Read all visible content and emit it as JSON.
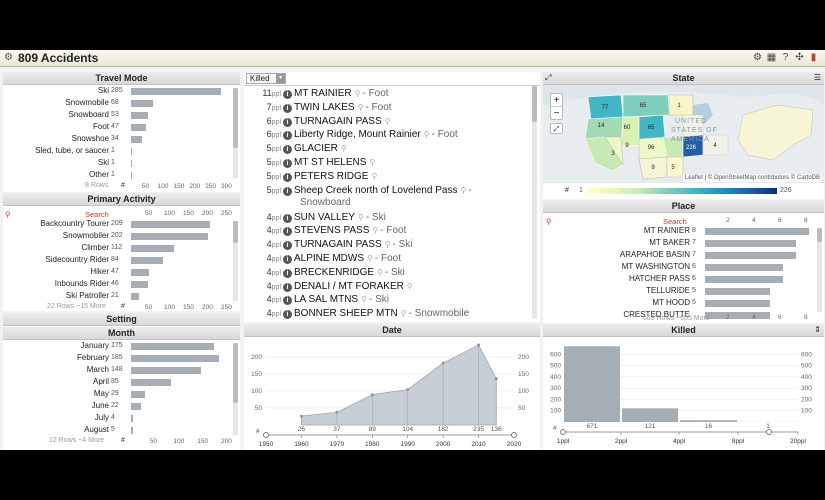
{
  "app": {
    "title": "809 Accidents"
  },
  "travel_mode": {
    "title": "Travel Mode",
    "items": [
      {
        "label": "Ski",
        "count": "285",
        "value": 285
      },
      {
        "label": "Snowmobile",
        "count": "68",
        "value": 68
      },
      {
        "label": "Snowboard",
        "count": "53",
        "value": 53
      },
      {
        "label": "Foot",
        "count": "47",
        "value": 47
      },
      {
        "label": "Snowshoe",
        "count": "34",
        "value": 34
      },
      {
        "label": "Sled, tube, or saucer",
        "count": "1",
        "value": 1
      },
      {
        "label": "Ski",
        "count": "1",
        "value": 1
      },
      {
        "label": "Other",
        "count": "1",
        "value": 1
      }
    ],
    "footer": "8 Rows",
    "axis": [
      "50",
      "100",
      "150",
      "200",
      "250",
      "300"
    ],
    "max": 300
  },
  "primary_activity": {
    "title": "Primary Activity",
    "search": "Search",
    "items": [
      {
        "label": "Backcountry Tourer",
        "count": "209",
        "value": 209
      },
      {
        "label": "Snowmobiler",
        "count": "202",
        "value": 202
      },
      {
        "label": "Climber",
        "count": "112",
        "value": 112
      },
      {
        "label": "Sidecountry Rider",
        "count": "84",
        "value": 84
      },
      {
        "label": "Hiker",
        "count": "47",
        "value": 47
      },
      {
        "label": "Inbounds Rider",
        "count": "46",
        "value": 46
      },
      {
        "label": "Ski Patroller",
        "count": "21",
        "value": 21
      }
    ],
    "footer": "22 Rows ~15 More",
    "axis": [
      "50",
      "100",
      "150",
      "200",
      "250"
    ],
    "max": 250
  },
  "setting": {
    "title": "Setting"
  },
  "month": {
    "title": "Month",
    "items": [
      {
        "label": "January",
        "count": "175",
        "value": 175
      },
      {
        "label": "February",
        "count": "185",
        "value": 185
      },
      {
        "label": "March",
        "count": "148",
        "value": 148
      },
      {
        "label": "April",
        "count": "85",
        "value": 85
      },
      {
        "label": "May",
        "count": "29",
        "value": 29
      },
      {
        "label": "June",
        "count": "22",
        "value": 22
      },
      {
        "label": "July",
        "count": "4",
        "value": 4
      },
      {
        "label": "August",
        "count": "5",
        "value": 5
      }
    ],
    "footer": "12 Rows ~4 More",
    "axis": [
      "50",
      "100",
      "150",
      "200"
    ],
    "max": 200
  },
  "killed_list": {
    "dropdown": "Killed",
    "unit": "ppl",
    "rows": [
      {
        "n": "11",
        "place": "MT RAINIER",
        "act": "Foot"
      },
      {
        "n": "7",
        "place": "TWIN LAKES",
        "act": "Foot"
      },
      {
        "n": "6",
        "place": "TURNAGAIN PASS",
        "act": ""
      },
      {
        "n": "6",
        "place": "Liberty Ridge, Mount Rainier",
        "act": "Foot"
      },
      {
        "n": "5",
        "place": "GLACIER",
        "act": ""
      },
      {
        "n": "5",
        "place": "MT ST HELENS",
        "act": ""
      },
      {
        "n": "5",
        "place": "PETERS RIDGE",
        "act": ""
      },
      {
        "n": "5",
        "place": "Sheep Creek north of Lovelend Pass",
        "act": "",
        "act2": "Snowboard"
      },
      {
        "n": "4",
        "place": "SUN VALLEY",
        "act": "Ski"
      },
      {
        "n": "4",
        "place": "STEVENS PASS",
        "act": "Foot"
      },
      {
        "n": "4",
        "place": "TURNAGAIN PASS",
        "act": "Ski"
      },
      {
        "n": "4",
        "place": "ALPINE MDWS",
        "act": "Foot"
      },
      {
        "n": "4",
        "place": "BRECKENRIDGE",
        "act": "Ski"
      },
      {
        "n": "4",
        "place": "DENALI / MT FORAKER",
        "act": ""
      },
      {
        "n": "4",
        "place": "LA SAL MTNS",
        "act": "Ski"
      },
      {
        "n": "4",
        "place": "BONNER SHEEP MTN",
        "act": "Snowmobile"
      }
    ]
  },
  "state": {
    "title": "State",
    "attribution": "Leaflet | © OpenStreetMap contributors © CartoDB",
    "map_text": [
      "UNITED",
      "STATES OF",
      "AMERICA"
    ],
    "legend_min": "1",
    "legend_max": "226",
    "zoom_in": "+",
    "zoom_out": "−",
    "labels": [
      "77",
      "65",
      "1",
      "14",
      "60",
      "65",
      "9",
      "96",
      "226",
      "9",
      "5",
      "3",
      "4"
    ]
  },
  "place": {
    "title": "Place",
    "search": "Search",
    "items": [
      {
        "label": "MT RAINIER",
        "count": "8",
        "value": 8
      },
      {
        "label": "MT BAKER",
        "count": "7",
        "value": 7
      },
      {
        "label": "ARAPAHOE BASIN",
        "count": "7",
        "value": 7
      },
      {
        "label": "MT WASHINGTON",
        "count": "6",
        "value": 6
      },
      {
        "label": "HATCHER PASS",
        "count": "6",
        "value": 6
      },
      {
        "label": "TELLURIDE",
        "count": "5",
        "value": 5
      },
      {
        "label": "MT HOOD",
        "count": "5",
        "value": 5
      },
      {
        "label": "CRESTED BUTTE",
        "count": "",
        "value": 5
      }
    ],
    "footer": "663 Rows ~655 More",
    "axis": [
      "2",
      "4",
      "6",
      "8"
    ],
    "max": 8
  },
  "chart_data": [
    {
      "type": "area",
      "title": "Date",
      "x": [
        1960,
        1970,
        1980,
        1990,
        2000,
        2010,
        2015
      ],
      "values": [
        26,
        37,
        89,
        104,
        182,
        235,
        136
      ],
      "xlim": [
        1950,
        2020
      ],
      "ylim": [
        0,
        235
      ],
      "xticks": [
        "1950",
        "1960",
        "1970",
        "1980",
        "1990",
        "2000",
        "2010",
        "2020"
      ],
      "yticks_left": [
        "200",
        "150",
        "100",
        "50"
      ],
      "yticks_right": [
        "200",
        "150",
        "100",
        "50"
      ],
      "data_labels": [
        "26",
        "37",
        "89",
        "104",
        "182",
        "235",
        "136"
      ]
    },
    {
      "type": "bar",
      "title": "Killed",
      "categories": [
        "1ppl",
        "2ppl",
        "4ppl",
        "8ppl"
      ],
      "values": [
        671,
        121,
        16,
        1
      ],
      "data_labels": [
        "671",
        "121",
        "16",
        "1"
      ],
      "ylim": [
        0,
        700
      ],
      "yticks": [
        "600",
        "500",
        "400",
        "300",
        "200",
        "100"
      ],
      "xticks": [
        "1ppl",
        "2ppl",
        "4ppl",
        "8ppl",
        "20ppl"
      ]
    }
  ]
}
